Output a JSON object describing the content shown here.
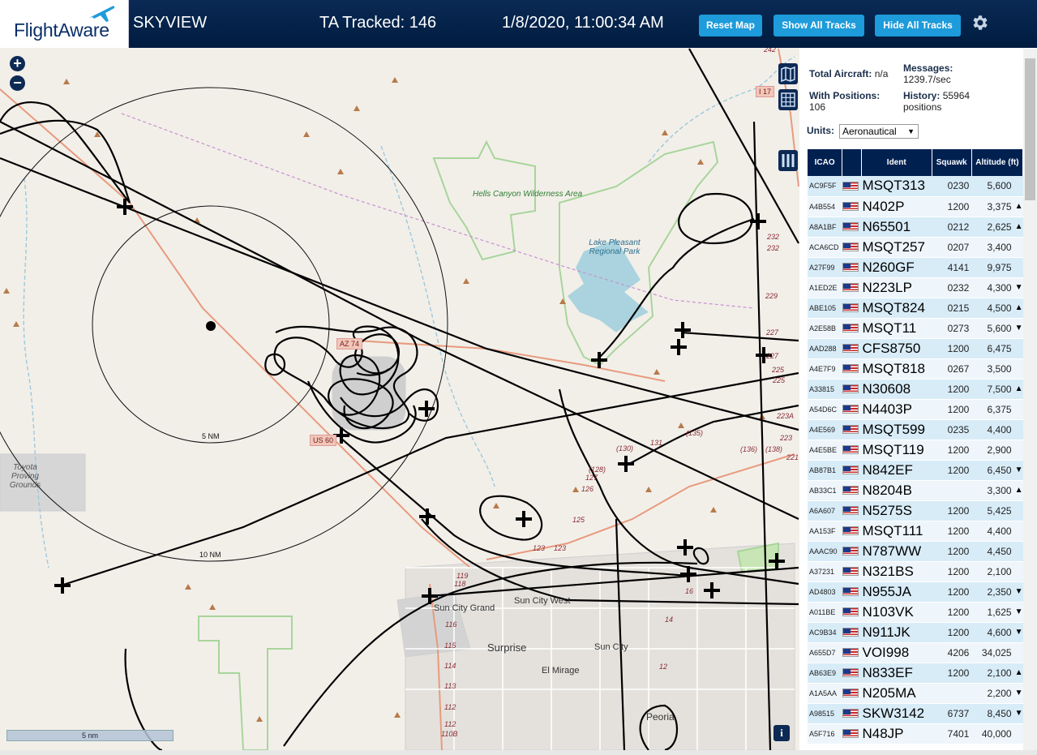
{
  "header": {
    "logo": "FlightAware",
    "app_name": "SKYVIEW",
    "tracked_label": "TA Tracked: 146",
    "datetime": "1/8/2020, 11:00:34 AM",
    "buttons": {
      "reset_map": "Reset Map",
      "show_all_tracks": "Show All Tracks",
      "hide_all_tracks": "Hide All Tracks"
    },
    "settings_icon": "gear-icon"
  },
  "map": {
    "zoom_in": "+",
    "zoom_out": "−",
    "scale_label": "5 nm",
    "info": "i",
    "ring_labels": [
      "5 NM",
      "10 NM"
    ],
    "place_labels": [
      "Hells Canyon Wilderness Area",
      "Lake Pleasant Regional Park",
      "Toyota Proving Grounds",
      "Sun City Grand",
      "Sun City West",
      "Surprise",
      "Sun City",
      "El Mirage",
      "Peoria"
    ],
    "shields": [
      "US 60",
      "AZ 74",
      "I 17"
    ],
    "road_numbers": [
      "(130)",
      "131",
      "(135)",
      "(136)",
      "(138)",
      "(128)",
      "127",
      "126",
      "125",
      "123",
      "123",
      "119",
      "118",
      "116",
      "115",
      "114",
      "113",
      "112",
      "112",
      "110B",
      "16",
      "14",
      "12",
      "221",
      "223",
      "223A",
      "225",
      "225",
      "227",
      "227",
      "229",
      "232",
      "232",
      "242"
    ],
    "colors": {
      "land": "#f2efe9",
      "water": "#aad3df",
      "park": "#c8e6b5",
      "track": "#000000",
      "road": "#e88b6f",
      "urban": "#dcdcdc"
    }
  },
  "panel": {
    "total_aircraft_label": "Total Aircraft:",
    "total_aircraft_value": "n/a",
    "messages_label": "Messages:",
    "messages_value": "1239.7/sec",
    "with_positions_label": "With Positions:",
    "with_positions_value": "106",
    "history_label": "History:",
    "history_value": "55964 positions",
    "units_label": "Units:",
    "units_value": "Aeronautical",
    "columns": [
      "ICAO",
      "",
      "Ident",
      "Squawk",
      "Altitude (ft)"
    ],
    "rows": [
      {
        "icao": "AC9F5F",
        "ident": "MSQT313",
        "squawk": "0230",
        "alt": "5,600",
        "trend": ""
      },
      {
        "icao": "A4B554",
        "ident": "N402P",
        "squawk": "1200",
        "alt": "3,375",
        "trend": "▲"
      },
      {
        "icao": "A8A1BF",
        "ident": "N65501",
        "squawk": "0212",
        "alt": "2,625",
        "trend": "▲"
      },
      {
        "icao": "ACA6CD",
        "ident": "MSQT257",
        "squawk": "0207",
        "alt": "3,400",
        "trend": ""
      },
      {
        "icao": "A27F99",
        "ident": "N260GF",
        "squawk": "4141",
        "alt": "9,975",
        "trend": ""
      },
      {
        "icao": "A1ED2E",
        "ident": "N223LP",
        "squawk": "0232",
        "alt": "4,300",
        "trend": "▼"
      },
      {
        "icao": "ABE105",
        "ident": "MSQT824",
        "squawk": "0215",
        "alt": "4,500",
        "trend": "▲"
      },
      {
        "icao": "A2E58B",
        "ident": "MSQT11",
        "squawk": "0273",
        "alt": "5,600",
        "trend": "▼"
      },
      {
        "icao": "AAD288",
        "ident": "CFS8750",
        "squawk": "1200",
        "alt": "6,475",
        "trend": ""
      },
      {
        "icao": "A4E7F9",
        "ident": "MSQT818",
        "squawk": "0267",
        "alt": "3,500",
        "trend": ""
      },
      {
        "icao": "A33815",
        "ident": "N30608",
        "squawk": "1200",
        "alt": "7,500",
        "trend": "▲"
      },
      {
        "icao": "A54D6C",
        "ident": "N4403P",
        "squawk": "1200",
        "alt": "6,375",
        "trend": ""
      },
      {
        "icao": "A4E569",
        "ident": "MSQT599",
        "squawk": "0235",
        "alt": "4,400",
        "trend": ""
      },
      {
        "icao": "A4E5BE",
        "ident": "MSQT119",
        "squawk": "1200",
        "alt": "2,900",
        "trend": ""
      },
      {
        "icao": "AB87B1",
        "ident": "N842EF",
        "squawk": "1200",
        "alt": "6,450",
        "trend": "▼"
      },
      {
        "icao": "AB33C1",
        "ident": "N8204B",
        "squawk": "",
        "alt": "3,300",
        "trend": "▲"
      },
      {
        "icao": "A6A607",
        "ident": "N5275S",
        "squawk": "1200",
        "alt": "5,425",
        "trend": ""
      },
      {
        "icao": "AA153F",
        "ident": "MSQT111",
        "squawk": "1200",
        "alt": "4,400",
        "trend": ""
      },
      {
        "icao": "AAAC90",
        "ident": "N787WW",
        "squawk": "1200",
        "alt": "4,450",
        "trend": ""
      },
      {
        "icao": "A37231",
        "ident": "N321BS",
        "squawk": "1200",
        "alt": "2,100",
        "trend": ""
      },
      {
        "icao": "AD4803",
        "ident": "N955JA",
        "squawk": "1200",
        "alt": "2,350",
        "trend": "▼"
      },
      {
        "icao": "A011BE",
        "ident": "N103VK",
        "squawk": "1200",
        "alt": "1,625",
        "trend": "▼"
      },
      {
        "icao": "AC9B34",
        "ident": "N911JK",
        "squawk": "1200",
        "alt": "4,600",
        "trend": "▼"
      },
      {
        "icao": "A655D7",
        "ident": "VOI998",
        "squawk": "4206",
        "alt": "34,025",
        "trend": ""
      },
      {
        "icao": "AB63E9",
        "ident": "N833EF",
        "squawk": "1200",
        "alt": "2,100",
        "trend": "▲"
      },
      {
        "icao": "A1A5AA",
        "ident": "N205MA",
        "squawk": "",
        "alt": "2,200",
        "trend": "▼"
      },
      {
        "icao": "A98515",
        "ident": "SKW3142",
        "squawk": "6737",
        "alt": "8,450",
        "trend": "▼"
      },
      {
        "icao": "A5F716",
        "ident": "N48JP",
        "squawk": "7401",
        "alt": "40,000",
        "trend": ""
      }
    ]
  }
}
